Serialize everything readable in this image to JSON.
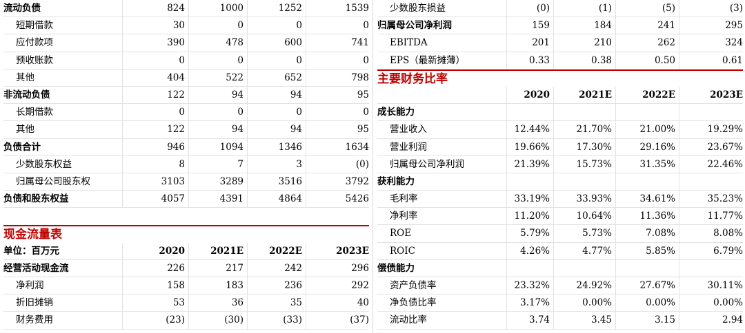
{
  "left": {
    "balance_rows": [
      {
        "label": "流动负债",
        "bold": true,
        "indent": false,
        "values": [
          "824",
          "1000",
          "1252",
          "1539"
        ]
      },
      {
        "label": "短期借款",
        "bold": false,
        "indent": true,
        "values": [
          "30",
          "0",
          "0",
          "0"
        ]
      },
      {
        "label": "应付款项",
        "bold": false,
        "indent": true,
        "values": [
          "390",
          "478",
          "600",
          "741"
        ]
      },
      {
        "label": "预收账款",
        "bold": false,
        "indent": true,
        "values": [
          "0",
          "0",
          "0",
          "0"
        ]
      },
      {
        "label": "其他",
        "bold": false,
        "indent": true,
        "values": [
          "404",
          "522",
          "652",
          "798"
        ]
      },
      {
        "label": "非流动负债",
        "bold": true,
        "indent": false,
        "values": [
          "122",
          "94",
          "94",
          "95"
        ]
      },
      {
        "label": "长期借款",
        "bold": false,
        "indent": true,
        "values": [
          "0",
          "0",
          "0",
          "0"
        ]
      },
      {
        "label": "其他",
        "bold": false,
        "indent": true,
        "values": [
          "122",
          "94",
          "94",
          "95"
        ]
      },
      {
        "label": "负债合计",
        "bold": true,
        "indent": false,
        "values": [
          "946",
          "1094",
          "1346",
          "1634"
        ]
      },
      {
        "label": "少数股东权益",
        "bold": false,
        "indent": true,
        "values": [
          "8",
          "7",
          "3",
          "(0)"
        ]
      },
      {
        "label": "归属母公司股东权",
        "bold": false,
        "indent": true,
        "values": [
          "3103",
          "3289",
          "3516",
          "3792"
        ]
      },
      {
        "label": "负债和股东权益",
        "bold": true,
        "indent": false,
        "values": [
          "4057",
          "4391",
          "4864",
          "5426"
        ]
      }
    ],
    "cashflow_title": "现金流量表",
    "cashflow_header": {
      "label": "单位：百万元",
      "years": [
        "2020",
        "2021E",
        "2022E",
        "2023E"
      ]
    },
    "cashflow_rows": [
      {
        "label": "经营活动现金流",
        "bold": true,
        "indent": false,
        "values": [
          "226",
          "217",
          "242",
          "296"
        ]
      },
      {
        "label": "净利润",
        "bold": false,
        "indent": true,
        "values": [
          "158",
          "183",
          "236",
          "292"
        ]
      },
      {
        "label": "折旧摊销",
        "bold": false,
        "indent": true,
        "values": [
          "53",
          "36",
          "35",
          "40"
        ]
      },
      {
        "label": "财务费用",
        "bold": false,
        "indent": true,
        "values": [
          "(23)",
          "(30)",
          "(33)",
          "(37)"
        ]
      }
    ]
  },
  "right": {
    "top_rows": [
      {
        "label": "少数股东损益",
        "bold": false,
        "indent": true,
        "values": [
          "(0)",
          "(1)",
          "(5)",
          "(3)"
        ]
      },
      {
        "label": "归属母公司净利润",
        "bold": true,
        "indent": false,
        "values": [
          "159",
          "184",
          "241",
          "295"
        ]
      },
      {
        "label": "EBITDA",
        "bold": false,
        "indent": true,
        "values": [
          "201",
          "210",
          "262",
          "324"
        ]
      },
      {
        "label": "EPS（最新摊薄）",
        "bold": false,
        "indent": true,
        "values": [
          "0.33",
          "0.38",
          "0.50",
          "0.61"
        ]
      }
    ],
    "ratio_title": "主要财务比率",
    "ratio_header": {
      "label": "",
      "years": [
        "2020",
        "2021E",
        "2022E",
        "2023E"
      ]
    },
    "ratio_rows": [
      {
        "label": "成长能力",
        "bold": true,
        "indent": false,
        "values": [
          "",
          "",
          "",
          ""
        ]
      },
      {
        "label": "营业收入",
        "bold": false,
        "indent": true,
        "values": [
          "12.44%",
          "21.70%",
          "21.00%",
          "19.29%"
        ]
      },
      {
        "label": "营业利润",
        "bold": false,
        "indent": true,
        "values": [
          "19.66%",
          "17.30%",
          "29.16%",
          "23.67%"
        ]
      },
      {
        "label": "归属母公司净利润",
        "bold": false,
        "indent": true,
        "values": [
          "21.39%",
          "15.73%",
          "31.35%",
          "22.46%"
        ]
      },
      {
        "label": "获利能力",
        "bold": true,
        "indent": false,
        "values": [
          "",
          "",
          "",
          ""
        ]
      },
      {
        "label": "毛利率",
        "bold": false,
        "indent": true,
        "values": [
          "33.19%",
          "33.93%",
          "34.61%",
          "35.23%"
        ]
      },
      {
        "label": "净利率",
        "bold": false,
        "indent": true,
        "values": [
          "11.20%",
          "10.64%",
          "11.36%",
          "11.77%"
        ]
      },
      {
        "label": "ROE",
        "bold": false,
        "indent": true,
        "values": [
          "5.79%",
          "5.73%",
          "7.08%",
          "8.08%"
        ]
      },
      {
        "label": "ROIC",
        "bold": false,
        "indent": true,
        "values": [
          "4.26%",
          "4.77%",
          "5.85%",
          "6.79%"
        ]
      },
      {
        "label": "偿债能力",
        "bold": true,
        "indent": false,
        "values": [
          "",
          "",
          "",
          ""
        ]
      },
      {
        "label": "资产负债率",
        "bold": false,
        "indent": true,
        "values": [
          "23.32%",
          "24.92%",
          "27.67%",
          "30.11%"
        ]
      },
      {
        "label": "净负债比率",
        "bold": false,
        "indent": true,
        "values": [
          "3.17%",
          "0.00%",
          "0.00%",
          "0.00%"
        ]
      },
      {
        "label": "流动比率",
        "bold": false,
        "indent": true,
        "values": [
          "3.74",
          "3.45",
          "3.15",
          "2.94"
        ]
      }
    ]
  }
}
